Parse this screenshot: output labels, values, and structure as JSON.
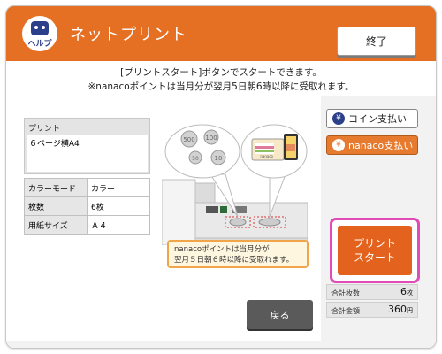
{
  "header": {
    "help_label": "ヘルプ",
    "title": "ネットプリント",
    "end_label": "終了"
  },
  "message": {
    "line1": "[プリントスタート]ボタンでスタートできます。",
    "line2": "※nanacoポイントは当月分が翌月5日朝6時以降に受取れます。"
  },
  "print_box": {
    "label": "プリント",
    "value": "６ページ横A4"
  },
  "spec": [
    {
      "key": "カラーモード",
      "value": "カラー"
    },
    {
      "key": "枚数",
      "value": "6枚"
    },
    {
      "key": "用紙サイズ",
      "value": "Ａ４"
    }
  ],
  "coins": [
    "500",
    "100",
    "50",
    "10"
  ],
  "card_label": "nanaco",
  "note": {
    "line1": "nanacoポイントは当月分が",
    "line2": "翌月５日朝６時以降に受取れます。"
  },
  "back_label": "戻る",
  "payment": {
    "coin_label": "コイン支払い",
    "nanaco_label": "nanaco支払い",
    "yen_symbol": "¥"
  },
  "start": {
    "line1": "プリント",
    "line2": "スタート"
  },
  "summary": {
    "count_label": "合計枚数",
    "count_value": "6",
    "count_unit": "枚",
    "amount_label": "合計金額",
    "amount_value": "360",
    "amount_unit": "円"
  },
  "colors": {
    "header": "#e56f23",
    "start_button": "#e3621d",
    "highlight": "#e14bb5",
    "note_border": "#f0a54a"
  }
}
